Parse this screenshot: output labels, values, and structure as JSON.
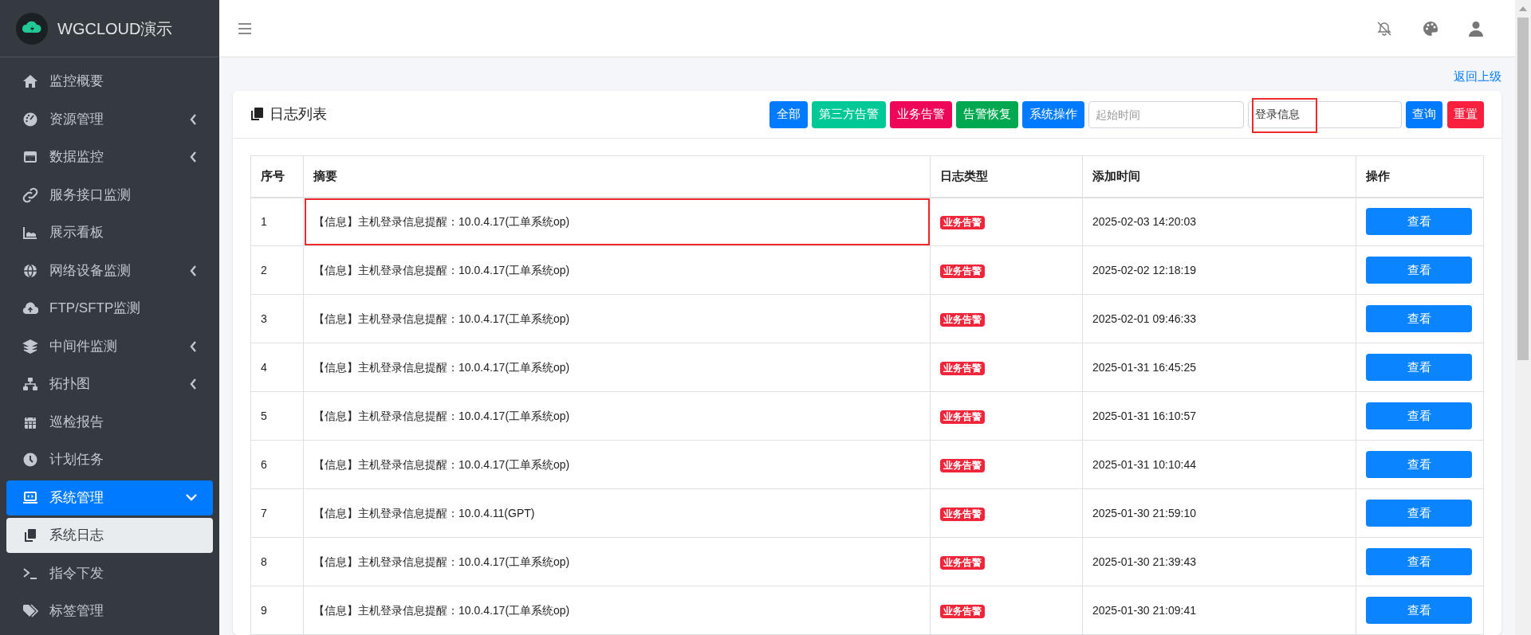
{
  "brand": {
    "title": "WGCLOUD演示"
  },
  "sidebar": {
    "items": [
      {
        "label": "监控概要",
        "kind": "link",
        "selected": false
      },
      {
        "label": "资源管理",
        "kind": "group",
        "expanded": false,
        "selected": false
      },
      {
        "label": "数据监控",
        "kind": "group",
        "expanded": false,
        "selected": false
      },
      {
        "label": "服务接口监测",
        "kind": "link",
        "selected": false
      },
      {
        "label": "展示看板",
        "kind": "link",
        "selected": false
      },
      {
        "label": "网络设备监测",
        "kind": "group",
        "expanded": false,
        "selected": false
      },
      {
        "label": "FTP/SFTP监测",
        "kind": "link",
        "selected": false
      },
      {
        "label": "中间件监测",
        "kind": "group",
        "expanded": false,
        "selected": false
      },
      {
        "label": "拓扑图",
        "kind": "group",
        "expanded": false,
        "selected": false
      },
      {
        "label": "巡检报告",
        "kind": "link",
        "selected": false
      },
      {
        "label": "计划任务",
        "kind": "link",
        "selected": false
      },
      {
        "label": "系统管理",
        "kind": "group",
        "expanded": true,
        "selected": true,
        "children": [
          {
            "label": "系统日志",
            "selected": true
          },
          {
            "label": "指令下发",
            "selected": false
          },
          {
            "label": "标签管理",
            "selected": false
          }
        ]
      }
    ]
  },
  "back_link": "返回上级",
  "card": {
    "title": "日志列表",
    "filters": [
      {
        "label": "全部",
        "color": "#007bff"
      },
      {
        "label": "第三方告警",
        "color": "#00c896"
      },
      {
        "label": "业务告警",
        "color": "#ee0658"
      },
      {
        "label": "告警恢复",
        "color": "#00a84f"
      },
      {
        "label": "系统操作",
        "color": "#007bff"
      }
    ],
    "start_time": {
      "placeholder": "起始时间"
    },
    "keyword": {
      "value": "登录信息",
      "highlighted": true
    },
    "query_button": "查询",
    "reset_button": "重置"
  },
  "table": {
    "columns": [
      "序号",
      "摘要",
      "日志类型",
      "添加时间",
      "操作"
    ],
    "rows": [
      {
        "no": "1",
        "summary": "【信息】主机登录信息提醒：10.0.4.17(工单系统op)",
        "type": "业务告警",
        "time": "2025-02-03 14:20:03",
        "action": "查看",
        "highlighted": true
      },
      {
        "no": "2",
        "summary": "【信息】主机登录信息提醒：10.0.4.17(工单系统op)",
        "type": "业务告警",
        "time": "2025-02-02 12:18:19",
        "action": "查看",
        "highlighted": false
      },
      {
        "no": "3",
        "summary": "【信息】主机登录信息提醒：10.0.4.17(工单系统op)",
        "type": "业务告警",
        "time": "2025-02-01 09:46:33",
        "action": "查看",
        "highlighted": false
      },
      {
        "no": "4",
        "summary": "【信息】主机登录信息提醒：10.0.4.17(工单系统op)",
        "type": "业务告警",
        "time": "2025-01-31 16:45:25",
        "action": "查看",
        "highlighted": false
      },
      {
        "no": "5",
        "summary": "【信息】主机登录信息提醒：10.0.4.17(工单系统op)",
        "type": "业务告警",
        "time": "2025-01-31 16:10:57",
        "action": "查看",
        "highlighted": false
      },
      {
        "no": "6",
        "summary": "【信息】主机登录信息提醒：10.0.4.17(工单系统op)",
        "type": "业务告警",
        "time": "2025-01-31 10:10:44",
        "action": "查看",
        "highlighted": false
      },
      {
        "no": "7",
        "summary": "【信息】主机登录信息提醒：10.0.4.11(GPT)",
        "type": "业务告警",
        "time": "2025-01-30 21:59:10",
        "action": "查看",
        "highlighted": false
      },
      {
        "no": "8",
        "summary": "【信息】主机登录信息提醒：10.0.4.17(工单系统op)",
        "type": "业务告警",
        "time": "2025-01-30 21:39:43",
        "action": "查看",
        "highlighted": false
      },
      {
        "no": "9",
        "summary": "【信息】主机登录信息提醒：10.0.4.17(工单系统op)",
        "type": "业务告警",
        "time": "2025-01-30 21:09:41",
        "action": "查看",
        "highlighted": false
      }
    ]
  }
}
